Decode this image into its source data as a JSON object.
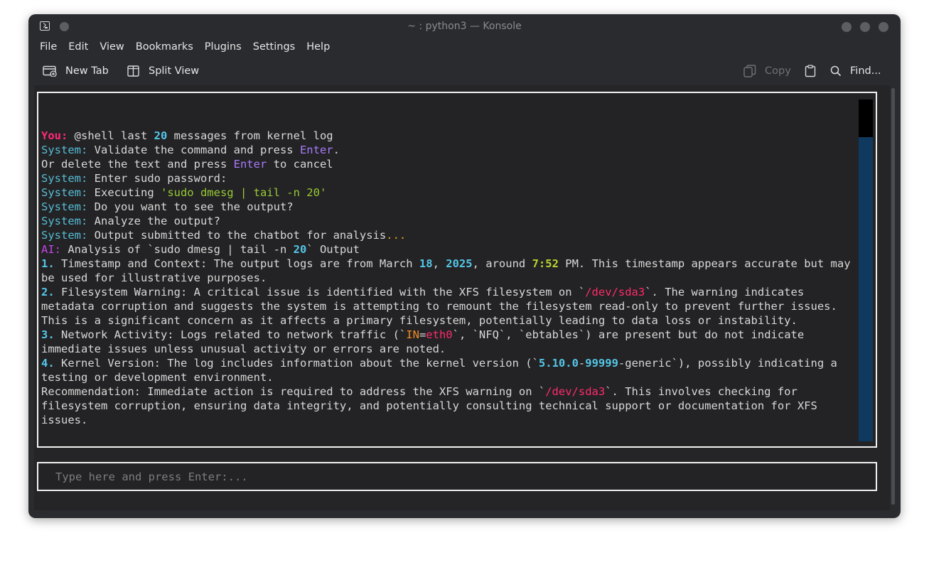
{
  "window": {
    "title": "~ : python3 — Konsole",
    "menu": [
      "File",
      "Edit",
      "View",
      "Bookmarks",
      "Plugins",
      "Settings",
      "Help"
    ],
    "toolbar": {
      "new_tab": "New Tab",
      "split_view": "Split View",
      "copy": "Copy",
      "find": "Find..."
    }
  },
  "chat": {
    "lines": [
      [
        {
          "t": "You:",
          "c": "c-you"
        },
        {
          "t": " @shell last "
        },
        {
          "t": "20",
          "c": "c-num"
        },
        {
          "t": " messages from kernel log"
        }
      ],
      [
        {
          "t": "System:",
          "c": "c-sys"
        },
        {
          "t": " Validate the command and press "
        },
        {
          "t": "Enter",
          "c": "c-key"
        },
        {
          "t": "."
        }
      ],
      [
        {
          "t": "Or delete the text and press "
        },
        {
          "t": "Enter",
          "c": "c-key"
        },
        {
          "t": " to cancel"
        }
      ],
      [
        {
          "t": "System:",
          "c": "c-sys"
        },
        {
          "t": " Enter sudo password:"
        }
      ],
      [
        {
          "t": "System:",
          "c": "c-sys"
        },
        {
          "t": " Executing "
        },
        {
          "t": "'sudo dmesg | tail -n 20'",
          "c": "c-cmd"
        }
      ],
      [
        {
          "t": "System:",
          "c": "c-sys"
        },
        {
          "t": " Do you want to see the output?"
        }
      ],
      [
        {
          "t": "System:",
          "c": "c-sys"
        },
        {
          "t": " Analyze the output?"
        }
      ],
      [
        {
          "t": "System:",
          "c": "c-sys"
        },
        {
          "t": " Output submitted to the chatbot for analysis"
        },
        {
          "t": "...",
          "c": "c-dots"
        }
      ],
      [
        {
          "t": "AI:",
          "c": "c-ai"
        },
        {
          "t": " Analysis of `sudo dmesg | tail -n "
        },
        {
          "t": "20",
          "c": "c-num"
        },
        {
          "t": "` Output"
        }
      ],
      [
        {
          "t": "1.",
          "c": "c-num"
        },
        {
          "t": " Timestamp and Context: The output logs are from March "
        },
        {
          "t": "18",
          "c": "c-num"
        },
        {
          "t": ", "
        },
        {
          "t": "2025",
          "c": "c-num"
        },
        {
          "t": ", around "
        },
        {
          "t": "7:52",
          "c": "c-time"
        },
        {
          "t": " PM. This timestamp appears accurate but may be used for illustrative purposes."
        }
      ],
      [
        {
          "t": "2.",
          "c": "c-num"
        },
        {
          "t": " Filesystem Warning: A critical issue is identified with the XFS filesystem on `"
        },
        {
          "t": "/dev/sda3",
          "c": "c-path"
        },
        {
          "t": "`. The warning indicates metadata corruption and suggests the system is attempting to remount the filesystem read-only to prevent further issues. This is a significant concern as it affects a primary filesystem, potentially leading to data loss or instability."
        }
      ],
      [
        {
          "t": "3.",
          "c": "c-num"
        },
        {
          "t": " Network Activity: Logs related to network traffic (`"
        },
        {
          "t": "IN",
          "c": "c-orange"
        },
        {
          "t": "="
        },
        {
          "t": "eth0",
          "c": "c-path"
        },
        {
          "t": "`, `NFQ`, `ebtables`) are present but do not indicate immediate issues unless unusual activity or errors are noted."
        }
      ],
      [
        {
          "t": "4.",
          "c": "c-num"
        },
        {
          "t": " Kernel Version: The log includes information about the kernel version (`"
        },
        {
          "t": "5.10.0",
          "c": "c-num"
        },
        {
          "t": "-"
        },
        {
          "t": "99999",
          "c": "c-num"
        },
        {
          "t": "-generic`), possibly indicating a testing or development environment."
        }
      ],
      [
        {
          "t": "Recommendation: Immediate action is required to address the XFS warning on `"
        },
        {
          "t": "/dev/sda3",
          "c": "c-path"
        },
        {
          "t": "`. This involves checking for filesystem corruption, ensuring data integrity, and potentially consulting technical support or documentation for XFS issues."
        }
      ]
    ]
  },
  "input": {
    "placeholder": "Type here and press Enter:...",
    "value": ""
  }
}
